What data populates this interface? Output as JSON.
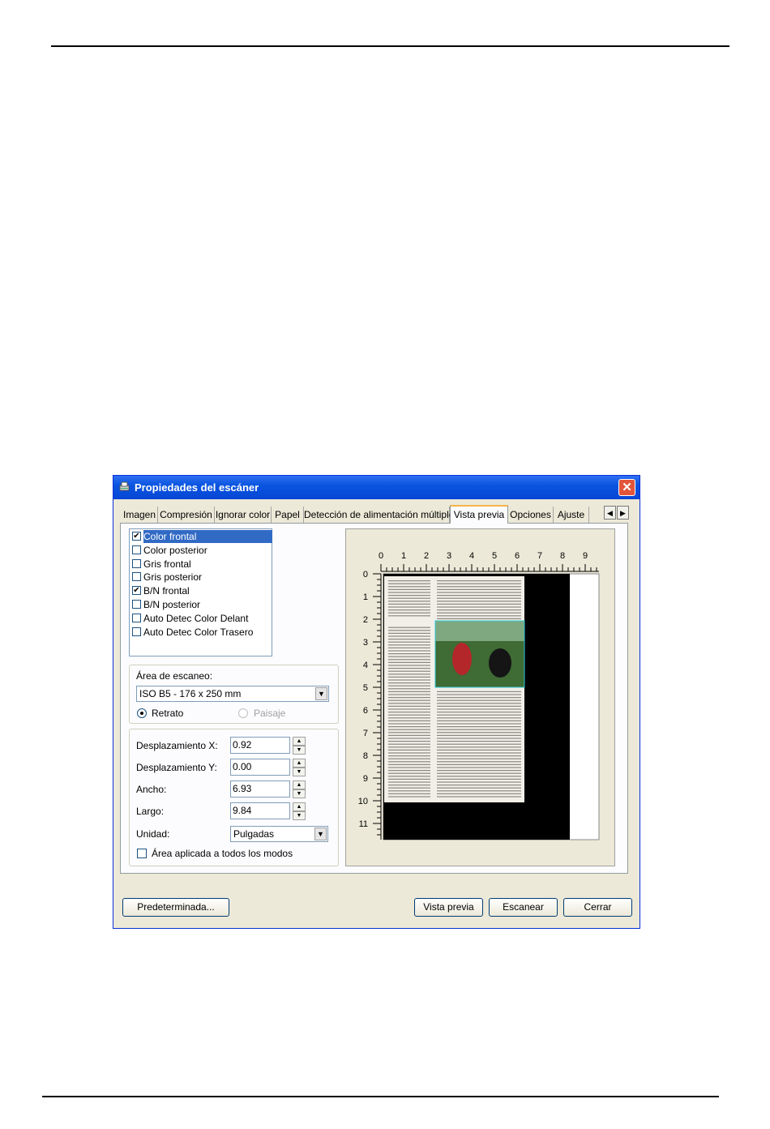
{
  "window": {
    "title": "Propiedades del escáner",
    "close_glyph": "✕",
    "tabs": [
      {
        "label": "Imagen"
      },
      {
        "label": "Compresión"
      },
      {
        "label": "Ignorar color"
      },
      {
        "label": "Papel"
      },
      {
        "label": "Detección de alimentación múltiple"
      },
      {
        "label": "Vista previa",
        "active": true
      },
      {
        "label": "Opciones"
      },
      {
        "label": "Ajuste"
      }
    ],
    "tab_scroll": {
      "left": "◀",
      "right": "▶"
    }
  },
  "image_list": [
    {
      "label": "Color frontal",
      "checked": true,
      "selected": true
    },
    {
      "label": "Color posterior",
      "checked": false
    },
    {
      "label": "Gris frontal",
      "checked": false
    },
    {
      "label": "Gris posterior",
      "checked": false
    },
    {
      "label": "B/N frontal",
      "checked": true
    },
    {
      "label": "B/N posterior",
      "checked": false
    },
    {
      "label": "Auto Detec Color Delant",
      "checked": false
    },
    {
      "label": "Auto Detec Color Trasero",
      "checked": false
    }
  ],
  "scan_area": {
    "label": "Área de escaneo:",
    "value": "ISO B5 - 176 x 250 mm",
    "orientation_portrait": "Retrato",
    "orientation_landscape": "Paisaje",
    "selected_orientation": "Retrato"
  },
  "offsets": {
    "x_label": "Desplazamiento X:",
    "x_value": "0.92",
    "y_label": "Desplazamiento Y:",
    "y_value": "0.00",
    "width_label": "Ancho:",
    "width_value": "6.93",
    "length_label": "Largo:",
    "length_value": "9.84",
    "unit_label": "Unidad:",
    "unit_value": "Pulgadas",
    "apply_all_label": "Área aplicada a todos los modos",
    "apply_all_checked": false
  },
  "ruler": {
    "x_ticks": [
      "0",
      "1",
      "2",
      "3",
      "4",
      "5",
      "6",
      "7",
      "8",
      "9"
    ],
    "y_ticks": [
      "0",
      "1",
      "2",
      "3",
      "4",
      "5",
      "6",
      "7",
      "8",
      "9",
      "10",
      "11"
    ]
  },
  "buttons": {
    "default": "Predeterminada...",
    "preview": "Vista previa",
    "scan": "Escanear",
    "close": "Cerrar"
  },
  "colors": {
    "titlebar": "#0a55e0",
    "dialog_bg": "#ece9d8",
    "selection": "#316ac5",
    "crop_frame": "#2ec8d8"
  }
}
